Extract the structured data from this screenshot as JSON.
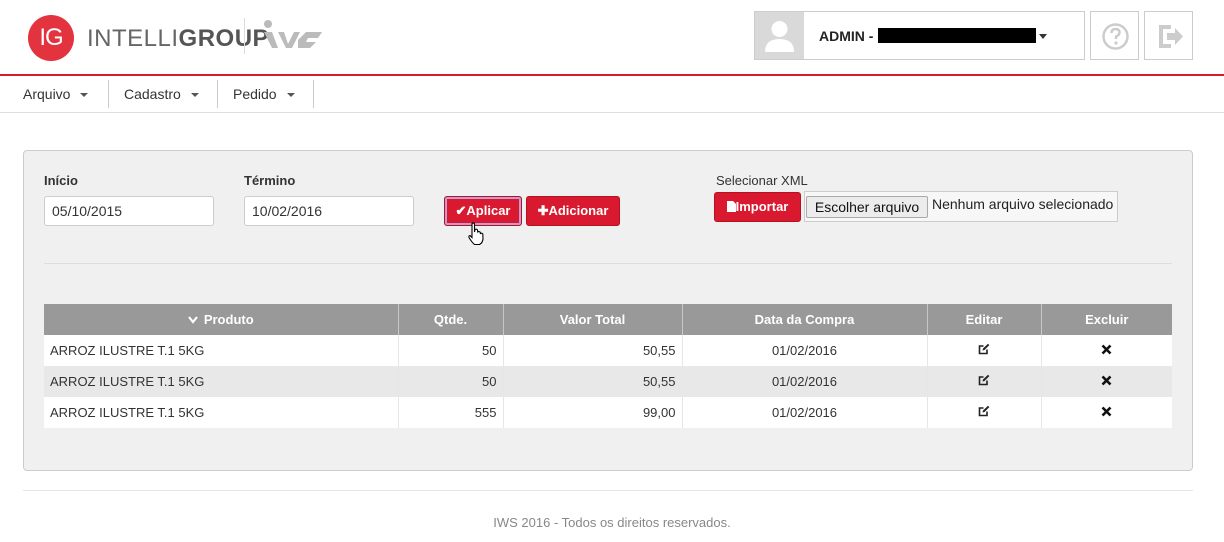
{
  "header": {
    "logo_mark": "IG",
    "logo_light": "INTELLI",
    "logo_bold": "GROUP",
    "brand_name": "IWS",
    "user_label": "ADMIN -"
  },
  "menu": {
    "items": [
      {
        "label": "Arquivo"
      },
      {
        "label": "Cadastro"
      },
      {
        "label": "Pedido"
      }
    ]
  },
  "filters": {
    "inicio_label": "Início",
    "inicio_value": "05/10/2015",
    "termino_label": "Término",
    "termino_value": "10/02/2016",
    "aplicar_label": "✔Aplicar",
    "adicionar_label": "✚Adicionar",
    "xml_label": "Selecionar XML",
    "importar_label": "Importar",
    "file_button_label": "Escolher arquivo",
    "file_none_label": "Nenhum arquivo selecionado"
  },
  "table": {
    "headers": {
      "produto": "Produto",
      "qtde": "Qtde.",
      "valor": "Valor Total",
      "data": "Data da Compra",
      "editar": "Editar",
      "excluir": "Excluir"
    },
    "rows": [
      {
        "produto": "ARROZ ILUSTRE T.1 5KG",
        "qtde": "50",
        "valor": "50,55",
        "data": "01/02/2016"
      },
      {
        "produto": "ARROZ ILUSTRE T.1 5KG",
        "qtde": "50",
        "valor": "50,55",
        "data": "01/02/2016"
      },
      {
        "produto": "ARROZ ILUSTRE T.1 5KG",
        "qtde": "555",
        "valor": "99,00",
        "data": "01/02/2016"
      }
    ]
  },
  "footer": {
    "text": "IWS 2016 - Todos os direitos reservados."
  },
  "colors": {
    "accent": "#d8192f",
    "table_header": "#999999"
  }
}
